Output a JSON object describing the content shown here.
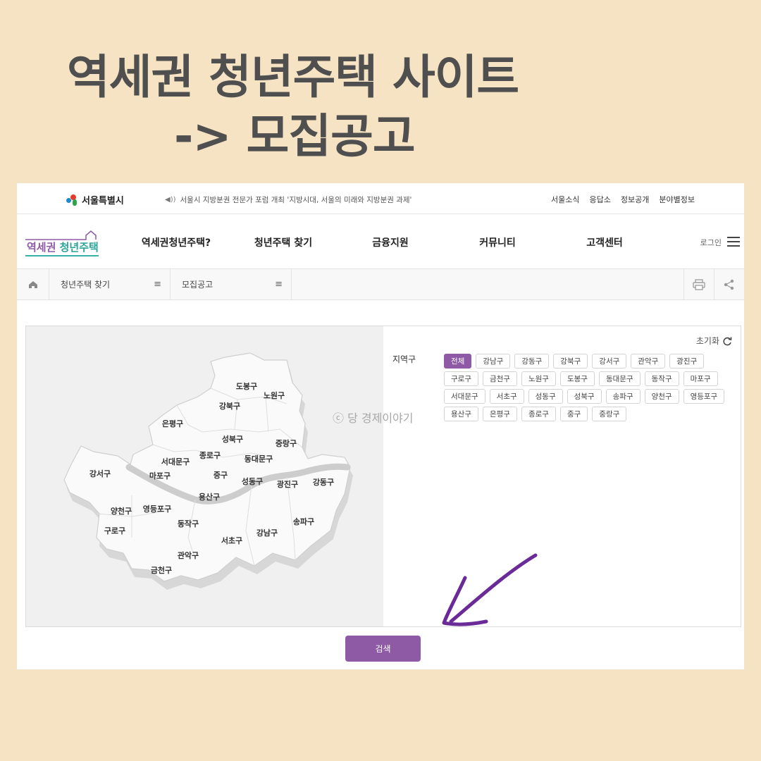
{
  "headline": {
    "line1": "역세권 청년주택 사이트",
    "line2": "-> 모집공고"
  },
  "topbar": {
    "seoul_logo": "서울특별시",
    "notice": "서울시 지방분권 전문가 포럼 개최 '지방시대, 서울의 미래와 지방분권 과제'",
    "links": [
      "서울소식",
      "응답소",
      "정보공개",
      "분야별정보"
    ]
  },
  "header": {
    "brand_a": "역세권 ",
    "brand_b": "청년주택",
    "nav": [
      "역세권청년주택?",
      "청년주택 찾기",
      "금융지원",
      "커뮤니티",
      "고객센터"
    ],
    "login": "로그인"
  },
  "breadcrumb": {
    "level1": "청년주택 찾기",
    "level2": "모집공고"
  },
  "filter": {
    "reset": "초기화",
    "label": "지역구",
    "districts": [
      "전체",
      "강남구",
      "강동구",
      "강북구",
      "강서구",
      "관악구",
      "광진구",
      "구로구",
      "금천구",
      "노원구",
      "도봉구",
      "동대문구",
      "동작구",
      "마포구",
      "서대문구",
      "서초구",
      "성동구",
      "성북구",
      "송파구",
      "양천구",
      "영등포구",
      "용산구",
      "은평구",
      "종로구",
      "중구",
      "중랑구"
    ],
    "selected": "전체"
  },
  "map_labels": [
    "도봉구",
    "노원구",
    "강북구",
    "은평구",
    "성북구",
    "중랑구",
    "종로구",
    "서대문구",
    "동대문구",
    "강서구",
    "마포구",
    "중구",
    "성동구",
    "광진구",
    "강동구",
    "용산구",
    "양천구",
    "영등포구",
    "동작구",
    "구로구",
    "서초구",
    "강남구",
    "송파구",
    "관악구",
    "금천구"
  ],
  "watermark": "ⓒ 당 경제이야기",
  "search_button": "검색",
  "colors": {
    "accent": "#8e5aa6",
    "teal": "#38b0a5",
    "background": "#f5e3c3"
  }
}
